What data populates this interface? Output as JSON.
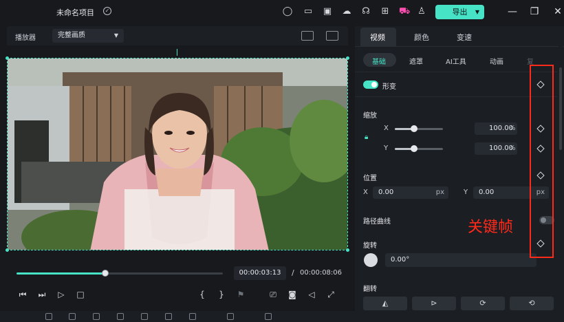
{
  "app": {
    "title": "未命名项目",
    "export_label": "导出",
    "accent_color": "#46e3c7",
    "topbar_icons": [
      "record-icon",
      "layout-icon",
      "save-icon",
      "cloud-icon",
      "headset-icon",
      "apps-icon",
      "cart-icon",
      "user-icon"
    ]
  },
  "player": {
    "label": "播放器",
    "quality": "完整画质",
    "current_time": "00:00:03:13",
    "separator": "/",
    "total_time": "00:00:08:06",
    "progress": 0.43,
    "controls": [
      "prev-frame-icon",
      "next-frame-icon",
      "play-icon",
      "stop-icon"
    ],
    "mark_in": "{",
    "mark_out": "}"
  },
  "panel": {
    "tabs": [
      {
        "label": "视频",
        "active": true
      },
      {
        "label": "颜色",
        "active": false
      },
      {
        "label": "变速",
        "active": false
      }
    ],
    "subtabs": [
      {
        "label": "基础",
        "active": true
      },
      {
        "label": "遮罩",
        "active": false
      },
      {
        "label": "AI工具",
        "active": false
      },
      {
        "label": "动画",
        "active": false
      },
      {
        "label": "复",
        "active": false
      }
    ],
    "transform": {
      "label": "形变",
      "enabled": true
    },
    "scale": {
      "label": "缩放",
      "x_label": "X",
      "y_label": "Y",
      "x_value": "100.00",
      "y_value": "100.00",
      "unit": "%",
      "x_slider": 0.4,
      "y_slider": 0.4
    },
    "position": {
      "label": "位置",
      "x_label": "X",
      "y_label": "Y",
      "x_value": "0.00",
      "y_value": "0.00",
      "unit": "px"
    },
    "path_curve": {
      "label": "路径曲线",
      "enabled": false
    },
    "rotation": {
      "label": "旋转",
      "value": "0.00°"
    },
    "flip": {
      "label": "翻转",
      "buttons": [
        "flip-horizontal-icon",
        "flip-vertical-icon",
        "rotate-right-icon",
        "rotate-left-icon"
      ]
    }
  },
  "annotation": {
    "text": "关键帧",
    "color": "#ff2a1a"
  }
}
